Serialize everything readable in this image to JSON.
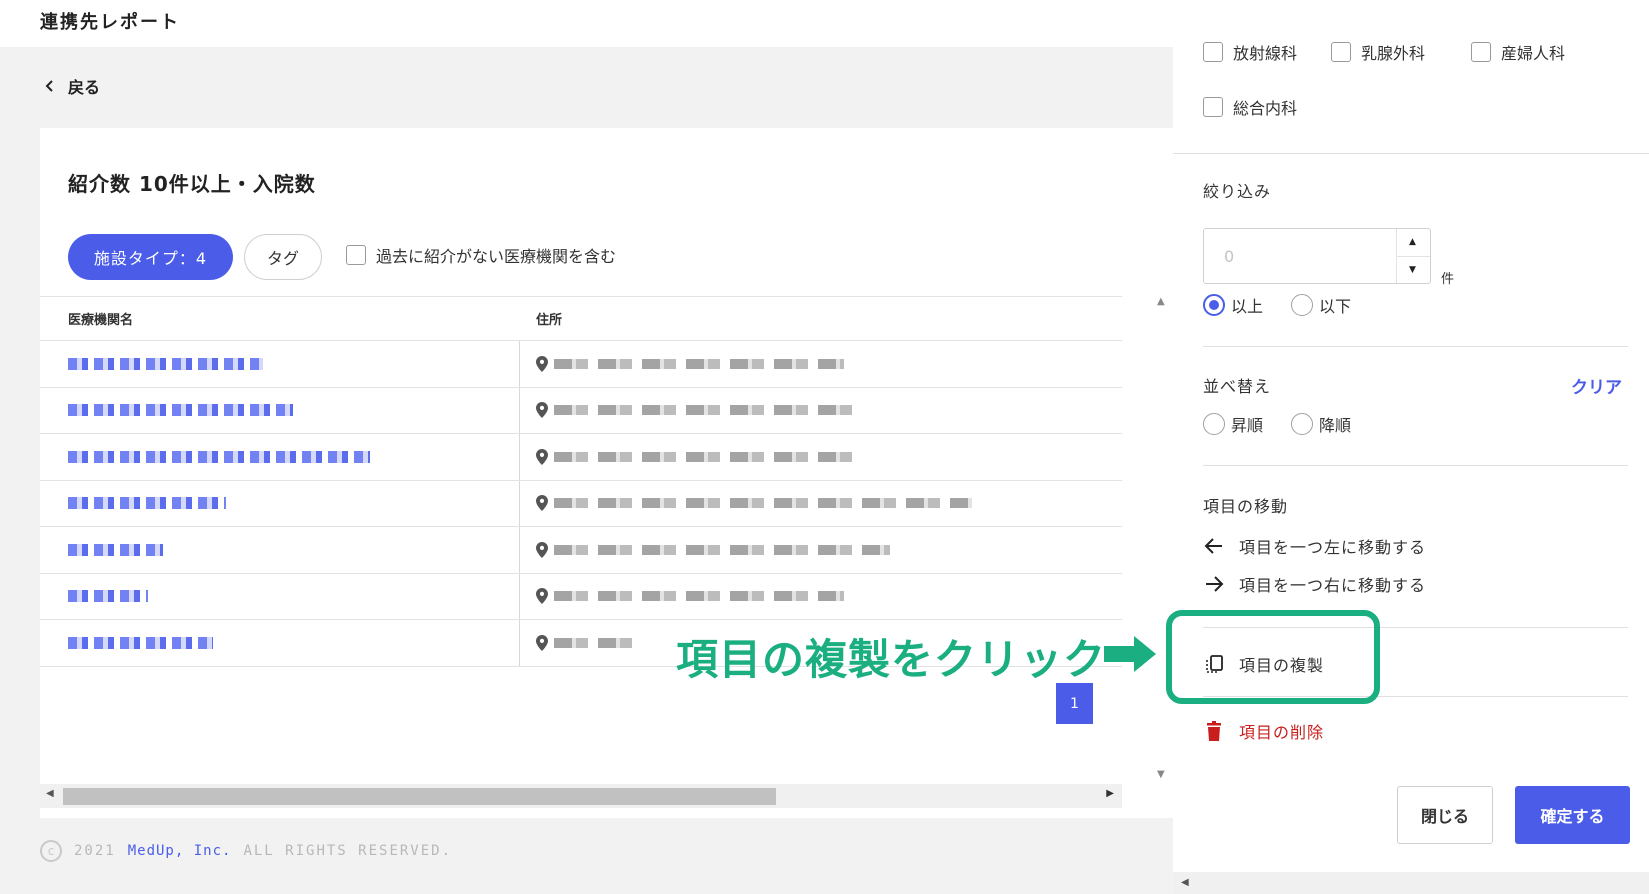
{
  "header": {
    "title": "連携先レポート"
  },
  "nav": {
    "back_label": "戻る"
  },
  "report": {
    "title": "紹介数 10件以上・入院数",
    "filter_facility_type": "施設タイプ：4",
    "filter_tag": "タグ",
    "include_past_label": "過去に紹介がない医療機関を含む",
    "columns": [
      "医療機関名",
      "住所"
    ],
    "row_count": 7,
    "pagination": {
      "current_page": "1"
    }
  },
  "footer": {
    "year": "2021",
    "brand": "MedUp, Inc.",
    "rights": "ALL RIGHTS RESERVED."
  },
  "panel": {
    "departments": [
      "放射線科",
      "乳腺外科",
      "産婦人科",
      "総合内科"
    ],
    "filter": {
      "label": "絞り込み",
      "value_placeholder": "0",
      "unit": "件",
      "options": [
        "以上",
        "以下"
      ],
      "selected": "以上"
    },
    "sort": {
      "label": "並べ替え",
      "clear_label": "クリア",
      "options": [
        "昇順",
        "降順"
      ]
    },
    "move": {
      "label": "項目の移動",
      "left_label": "項目を一つ左に移動する",
      "right_label": "項目を一つ右に移動する"
    },
    "duplicate_label": "項目の複製",
    "delete_label": "項目の削除",
    "close_label": "閉じる",
    "confirm_label": "確定する"
  },
  "annotation": {
    "text": "項目の複製をクリック",
    "color": "#1aae80"
  },
  "colors": {
    "accent": "#4b5de8",
    "danger": "#c81e1e"
  }
}
